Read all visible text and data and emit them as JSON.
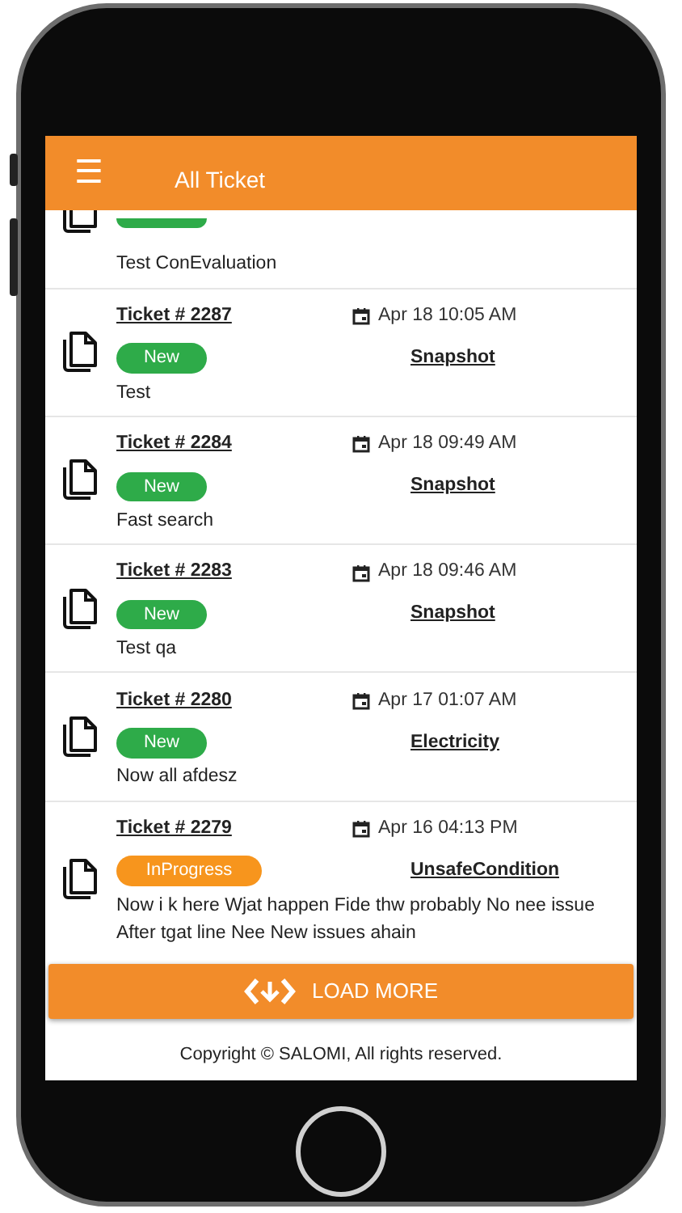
{
  "header": {
    "menu_icon": "☰",
    "title": "All Ticket"
  },
  "tickets": [
    {
      "kind": "partial",
      "color": "#2eab49",
      "description": "Test ConEvaluation"
    },
    {
      "kind": "full",
      "number": "Ticket # 2287",
      "date": "Apr 18 10:05 AM",
      "color": "#2eab49",
      "status_label": "New",
      "category": "Snapshot",
      "description": "Test"
    },
    {
      "kind": "full",
      "number": "Ticket # 2284",
      "date": "Apr 18 09:49 AM",
      "color": "#2eab49",
      "status_label": "New",
      "category": "Snapshot",
      "description": "Fast search"
    },
    {
      "kind": "full",
      "number": "Ticket # 2283",
      "date": "Apr 18 09:46 AM",
      "color": "#2eab49",
      "status_label": "New",
      "category": "Snapshot",
      "description": "Test qa"
    },
    {
      "kind": "full",
      "number": "Ticket # 2280",
      "date": "Apr 17 01:07 AM",
      "color": "#2eab49",
      "status_label": "New",
      "category": "Electricity",
      "description": "Now all afdesz"
    },
    {
      "kind": "full",
      "number": "Ticket # 2279",
      "date": "Apr 16 04:13 PM",
      "color": "#f7951d",
      "status_label": "InProgress",
      "category": "UnsafeCondition",
      "description": "Now i k here Wjat happen Fide thw probably No nee issue After tgat line Nee New issues ahain"
    }
  ],
  "load_more": "LOAD MORE",
  "footer": "Copyright © SALOMI, All rights reserved."
}
